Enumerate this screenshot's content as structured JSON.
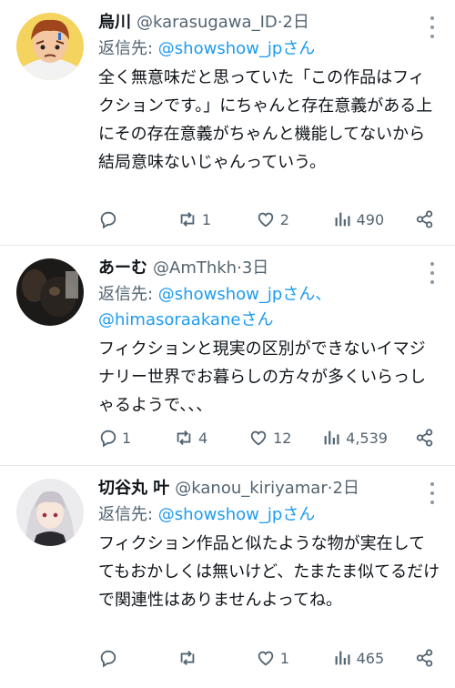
{
  "tweets": [
    {
      "name": "烏川",
      "handle": "@karasugawa_ID",
      "time": "2日",
      "reply_prefix": "返信先: ",
      "reply_to": "@showshow_jpさん",
      "text": "全く無意味だと思っていた「この作品はフィクションです。」にちゃんと存在意義がある上にその存在意義がちゃんと機能してないから結局意味ないじゃんっていう。",
      "replies": "",
      "retweets": "1",
      "likes": "2",
      "views": "490"
    },
    {
      "name": "あーむ",
      "handle": "@AmThkh",
      "time": "3日",
      "reply_prefix": "返信先: ",
      "reply_to": "@showshow_jpさん、",
      "reply_to2": "@himasoraakaneさん",
      "text": "フィクションと現実の区別ができないイマジナリー世界でお暮らしの方々が多くいらっしゃるようで、、、",
      "replies": "1",
      "retweets": "4",
      "likes": "12",
      "views": "4,539"
    },
    {
      "name": "切谷丸 叶",
      "handle": "@kanou_kiriyamar",
      "time": "2日",
      "reply_prefix": "返信先: ",
      "reply_to": "@showshow_jpさん",
      "text": "フィクション作品と似たような物が実在しててもおかしくは無いけど、たまたま似てるだけで関連性はありませんよってね。",
      "replies": "",
      "retweets": "",
      "likes": "1",
      "views": "465"
    }
  ],
  "separator": " · ",
  "colors": {
    "link": "#1d9bf0",
    "muted": "#536471",
    "border": "#e6e9ec"
  },
  "icons": [
    "reply-icon",
    "retweet-icon",
    "like-icon",
    "views-icon",
    "share-icon",
    "more-icon"
  ]
}
